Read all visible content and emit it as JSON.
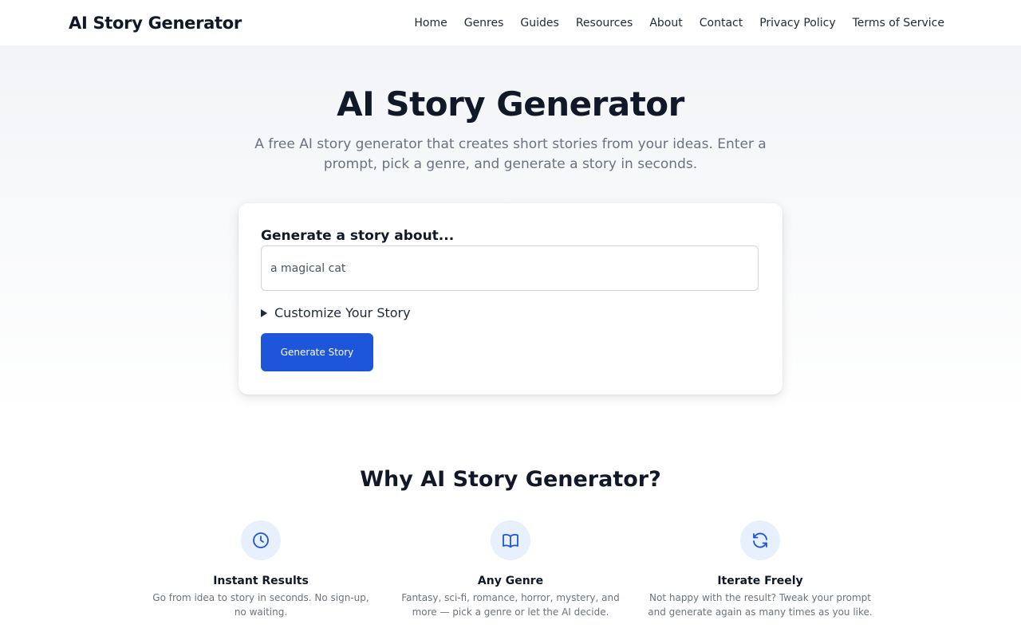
{
  "header": {
    "brand": "AI Story Generator",
    "nav": [
      "Home",
      "Genres",
      "Guides",
      "Resources",
      "About",
      "Contact",
      "Privacy Policy",
      "Terms of Service"
    ]
  },
  "hero": {
    "title": "AI Story Generator",
    "subtitle": "A free AI story generator that creates short stories from your ideas. Enter a prompt, pick a genre, and generate a story in seconds."
  },
  "form": {
    "label": "Generate a story about...",
    "input_value": "a magical cat",
    "customize_label": "Customize Your Story",
    "generate_label": "Generate Story"
  },
  "why": {
    "title": "Why AI Story Generator?",
    "features": [
      {
        "icon": "clock-icon",
        "title": "Instant Results",
        "desc": "Go from idea to story in seconds. No sign-up, no waiting."
      },
      {
        "icon": "book-open-icon",
        "title": "Any Genre",
        "desc": "Fantasy, sci-fi, romance, horror, mystery, and more — pick a genre or let the AI decide."
      },
      {
        "icon": "refresh-icon",
        "title": "Iterate Freely",
        "desc": "Not happy with the result? Tweak your prompt and generate again as many times as you like."
      }
    ]
  },
  "colors": {
    "accent": "#1d56db",
    "icon_bg": "#e8f0fd",
    "text_dark": "#111827",
    "text_muted": "#6b7280"
  }
}
